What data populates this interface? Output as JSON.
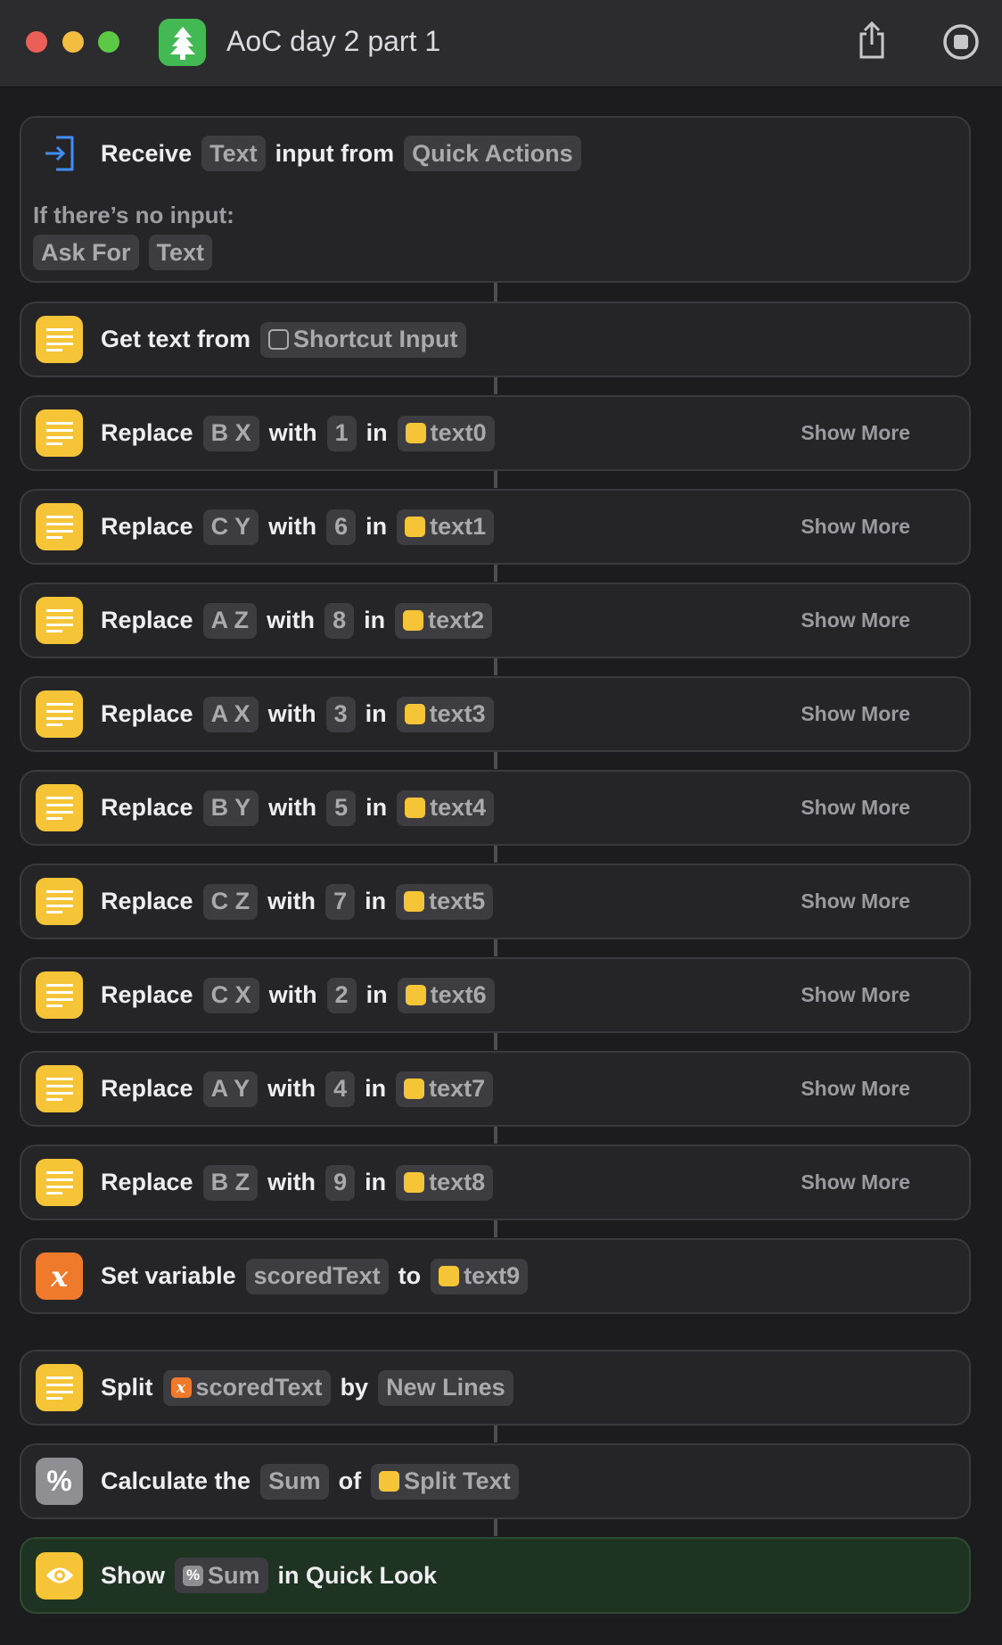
{
  "window": {
    "title": "AoC day 2 part 1"
  },
  "receive": {
    "w_receive": "Receive",
    "type_token": "Text",
    "w_input_from": "input from",
    "source_token": "Quick Actions",
    "no_input_label": "If there’s no input:",
    "ask_for_token": "Ask For",
    "text_token": "Text"
  },
  "get_text": {
    "label": "Get text from",
    "input_token": "Shortcut Input"
  },
  "replace_word": "Replace",
  "with_word": "with",
  "in_word": "in",
  "show_more": "Show More",
  "replaces": [
    {
      "find": "B X",
      "value": "1",
      "source": "text0"
    },
    {
      "find": "C Y",
      "value": "6",
      "source": "text1"
    },
    {
      "find": "A Z",
      "value": "8",
      "source": "text2"
    },
    {
      "find": "A X",
      "value": "3",
      "source": "text3"
    },
    {
      "find": "B Y",
      "value": "5",
      "source": "text4"
    },
    {
      "find": "C Z",
      "value": "7",
      "source": "text5"
    },
    {
      "find": "C X",
      "value": "2",
      "source": "text6"
    },
    {
      "find": "A Y",
      "value": "4",
      "source": "text7"
    },
    {
      "find": "B Z",
      "value": "9",
      "source": "text8"
    }
  ],
  "set_var": {
    "label": "Set variable",
    "var_token": "scoredText",
    "to_word": "to",
    "value_token": "text9"
  },
  "split": {
    "label": "Split",
    "var_token": "scoredText",
    "by_word": "by",
    "sep_token": "New Lines"
  },
  "calc": {
    "label": "Calculate the",
    "op_token": "Sum",
    "of_word": "of",
    "src_token": "Split Text"
  },
  "show": {
    "label": "Show",
    "token": "Sum",
    "suffix": "in Quick Look"
  },
  "colors": {
    "text_action": "#f5c537",
    "variable_action": "#ef7a2c",
    "math_action": "#8e8e93",
    "show_card_bg": "#1f3323"
  },
  "icons": [
    "share-icon",
    "stop-icon",
    "shortcut-input-icon",
    "text-lines-icon",
    "variable-x-icon",
    "percent-icon",
    "eye-icon"
  ]
}
